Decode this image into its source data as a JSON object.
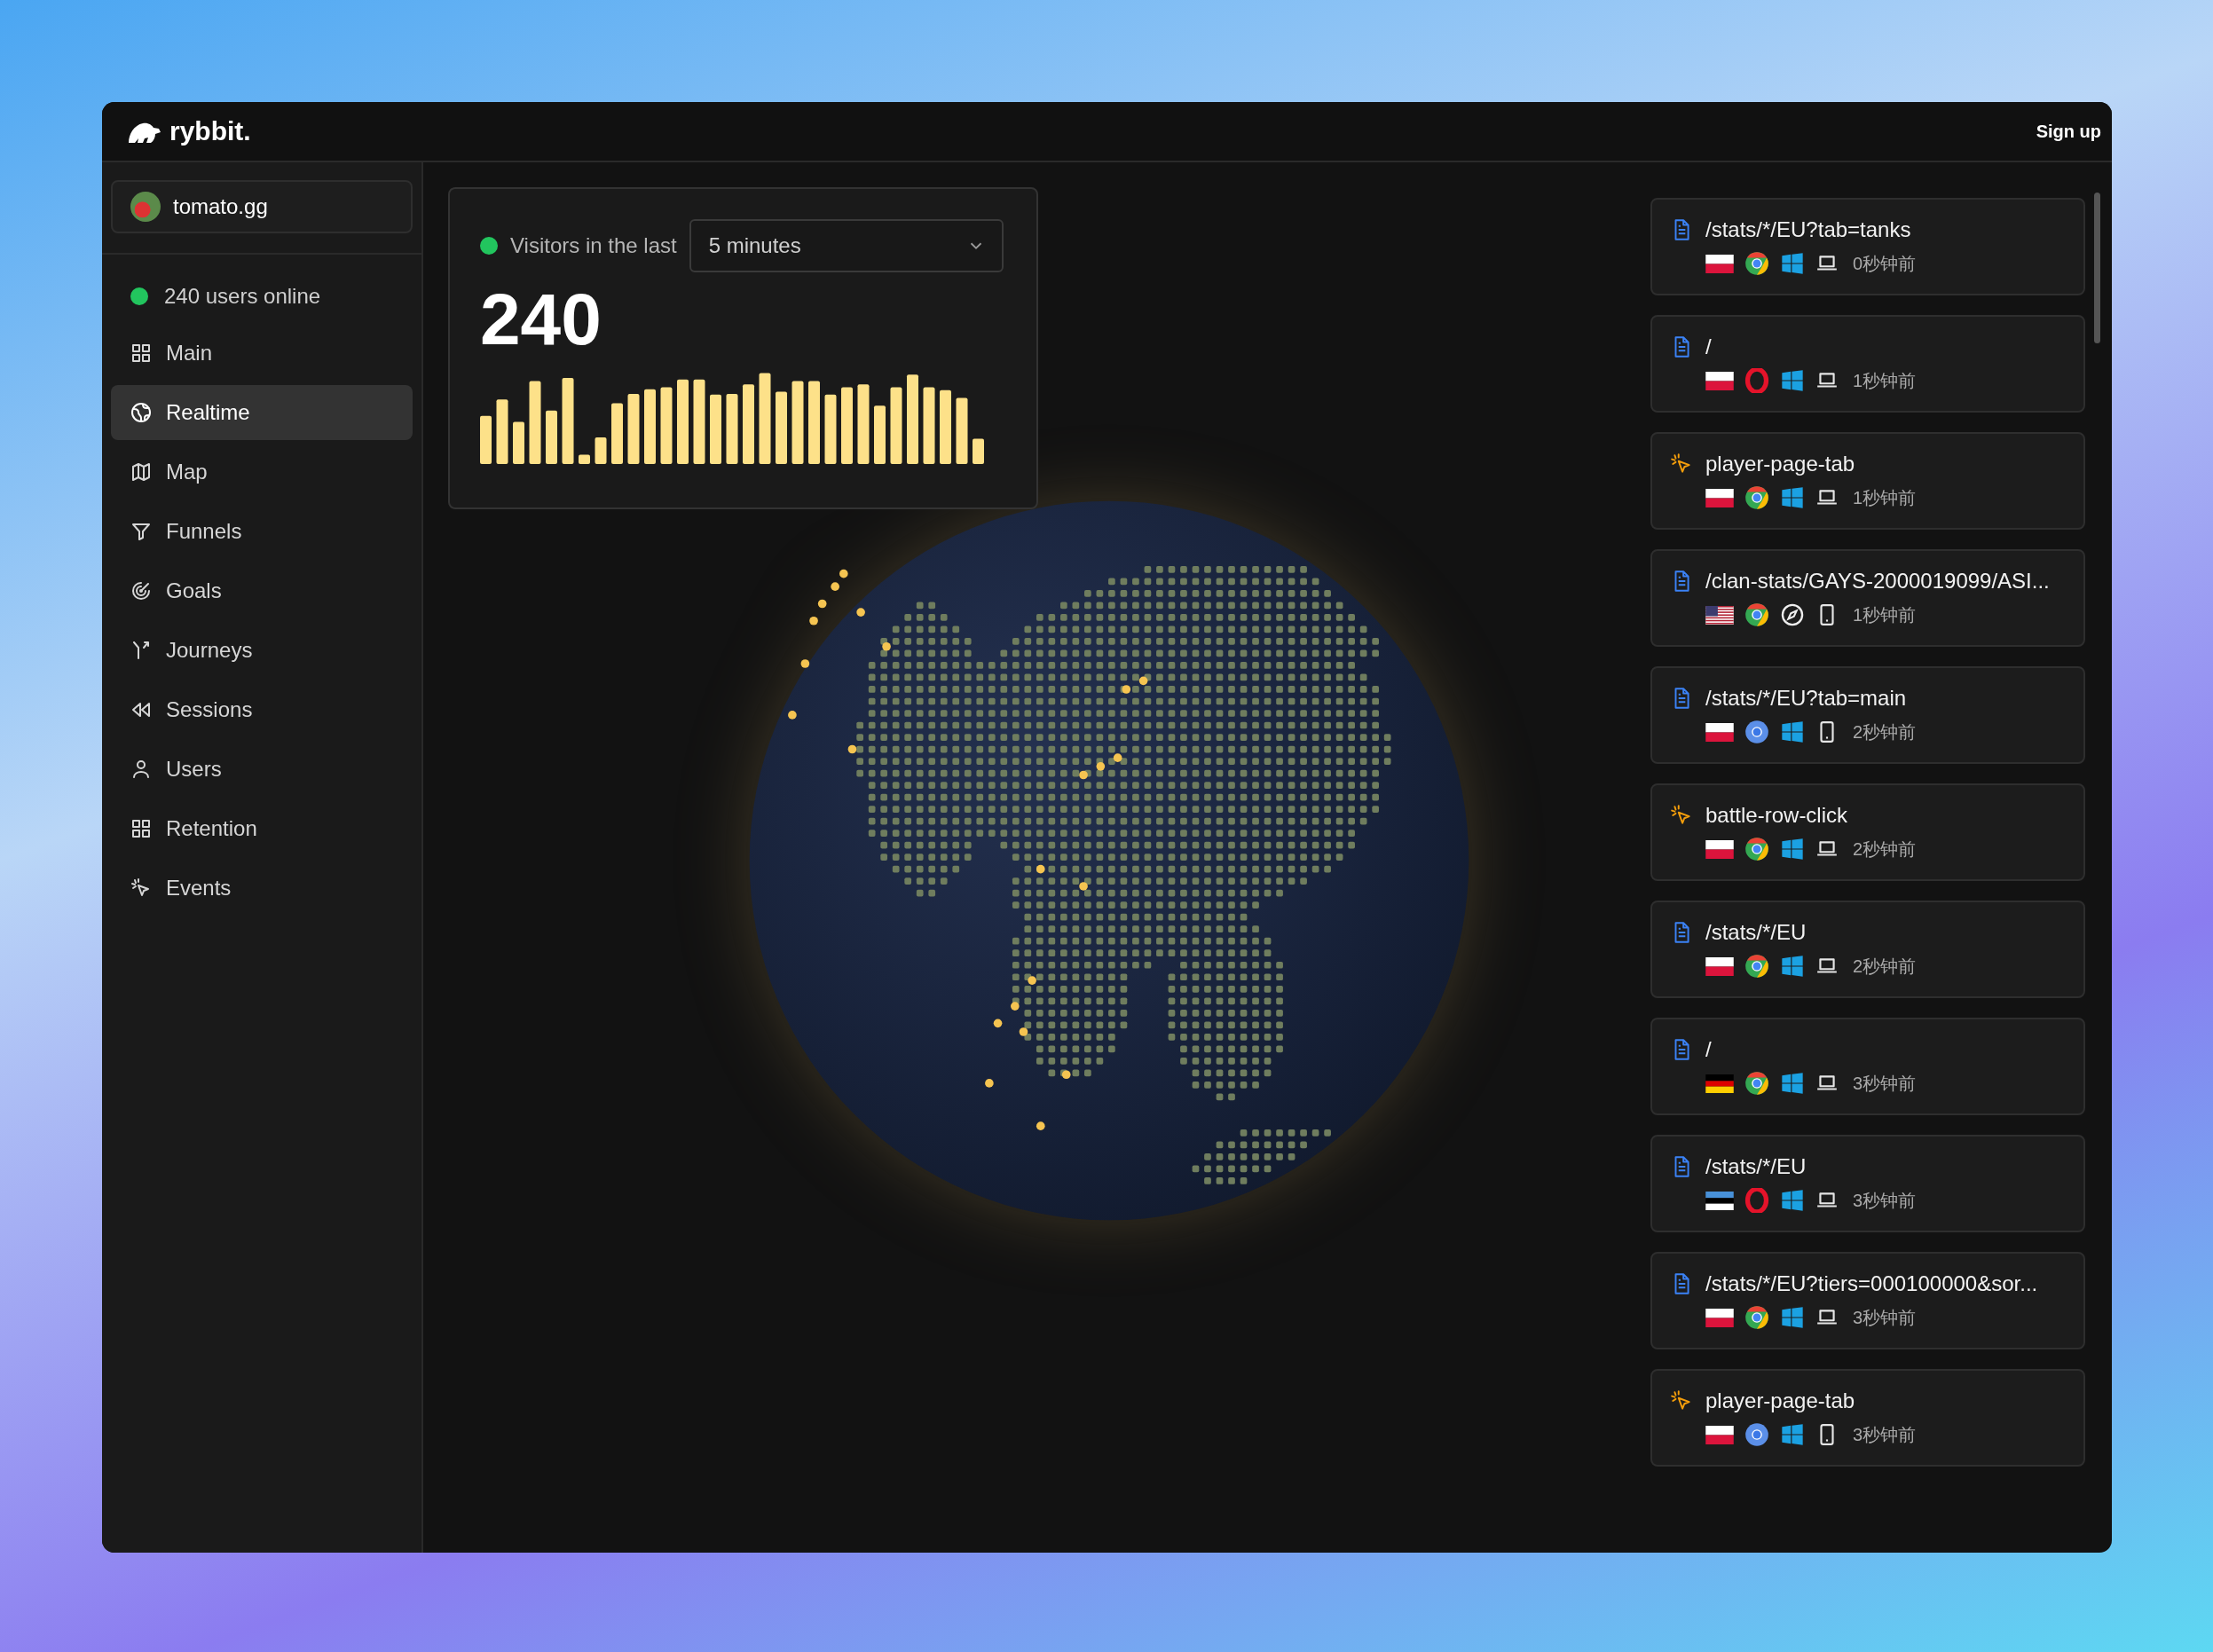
{
  "header": {
    "logo": "rybbit.",
    "signup": "Sign up"
  },
  "sidebar": {
    "site": "tomato.gg",
    "online": "240 users online",
    "items": [
      {
        "label": "Main",
        "selected": false
      },
      {
        "label": "Realtime",
        "selected": true
      },
      {
        "label": "Map",
        "selected": false
      },
      {
        "label": "Funnels",
        "selected": false
      },
      {
        "label": "Goals",
        "selected": false
      },
      {
        "label": "Journeys",
        "selected": false
      },
      {
        "label": "Sessions",
        "selected": false
      },
      {
        "label": "Users",
        "selected": false
      },
      {
        "label": "Retention",
        "selected": false
      },
      {
        "label": "Events",
        "selected": false
      }
    ]
  },
  "visitors": {
    "label": "Visitors in the last",
    "range": "5 minutes",
    "count": "240"
  },
  "events": [
    {
      "kind": "pageview",
      "path": "/stats/*/EU?tab=tanks",
      "time": "0秒钟前"
    },
    {
      "kind": "pageview",
      "path": "/",
      "time": "1秒钟前"
    },
    {
      "kind": "event",
      "path": "player-page-tab",
      "time": "1秒钟前"
    },
    {
      "kind": "pageview",
      "path": "/clan-stats/GAYS-2000019099/ASI...",
      "time": "1秒钟前"
    },
    {
      "kind": "pageview",
      "path": "/stats/*/EU?tab=main",
      "time": "2秒钟前"
    },
    {
      "kind": "event",
      "path": "battle-row-click",
      "time": "2秒钟前"
    },
    {
      "kind": "pageview",
      "path": "/stats/*/EU",
      "time": "2秒钟前"
    },
    {
      "kind": "pageview",
      "path": "/",
      "time": "3秒钟前"
    },
    {
      "kind": "pageview",
      "path": "/stats/*/EU",
      "time": "3秒钟前"
    },
    {
      "kind": "pageview",
      "path": "/stats/*/EU?tiers=000100000&sor...",
      "time": "3秒钟前"
    },
    {
      "kind": "event",
      "path": "player-page-tab",
      "time": "3秒钟前"
    }
  ]
}
